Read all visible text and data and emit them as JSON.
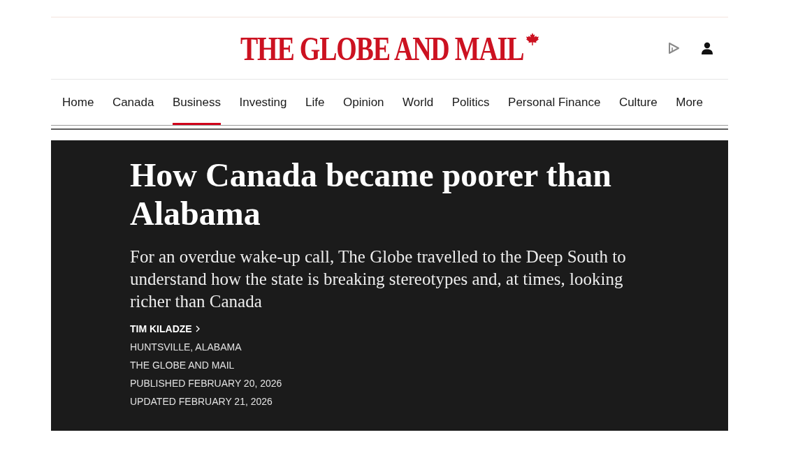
{
  "header": {
    "logo": "THE GLOBE AND MAIL"
  },
  "nav": [
    {
      "label": "Home",
      "selected": false
    },
    {
      "label": "Canada",
      "selected": false
    },
    {
      "label": "Business",
      "selected": true
    },
    {
      "label": "Investing",
      "selected": false
    },
    {
      "label": "Life",
      "selected": false
    },
    {
      "label": "Opinion",
      "selected": false
    },
    {
      "label": "World",
      "selected": false
    },
    {
      "label": "Politics",
      "selected": false
    },
    {
      "label": "Personal Finance",
      "selected": false
    },
    {
      "label": "Culture",
      "selected": false
    },
    {
      "label": "More",
      "selected": false
    }
  ],
  "article": {
    "headline": "How Canada became poorer than Alabama",
    "dek": "For an overdue wake-up call, The Globe travelled to the Deep South to understand how the state is breaking stereotypes and, at times, looking richer than Canada",
    "author": "TIM KILADZE",
    "meta": [
      "HUNTSVILLE, ALABAMA",
      "THE GLOBE AND MAIL",
      "PUBLISHED FEBRUARY 20, 2026",
      "UPDATED FEBRUARY 21, 2026"
    ]
  }
}
